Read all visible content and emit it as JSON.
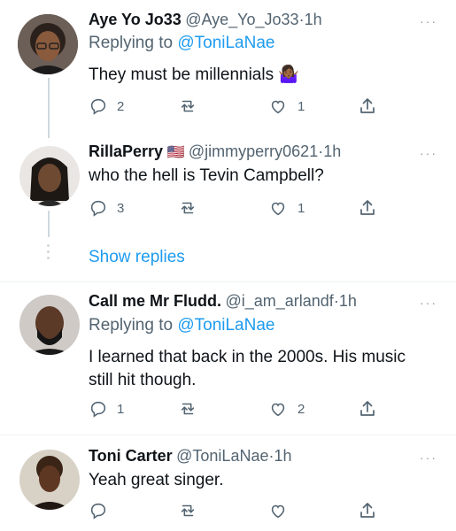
{
  "tweets": [
    {
      "name": "Aye Yo Jo33",
      "handle": "@Aye_Yo_Jo33",
      "time": "1h",
      "reply_prefix": "Replying to",
      "reply_to": "@ToniLaNae",
      "text": "They must be millennials",
      "emoji": "🤷🏾‍♀️",
      "counts": {
        "reply": "2",
        "retweet": "",
        "like": "1"
      }
    },
    {
      "name": "RillaPerry",
      "flag": "🇺🇸",
      "handle": "@jimmyperry0621",
      "time": "1h",
      "text": "who the hell is Tevin Campbell?",
      "counts": {
        "reply": "3",
        "retweet": "",
        "like": "1"
      }
    },
    {
      "name": "Call me Mr Fludd.",
      "handle": "@i_am_arlandf",
      "time": "1h",
      "reply_prefix": "Replying to",
      "reply_to": "@ToniLaNae",
      "text_line1": "I learned that back in the 2000s. His music",
      "text_line2": "still hit though.",
      "counts": {
        "reply": "1",
        "retweet": "",
        "like": "2"
      }
    },
    {
      "name": "Toni Carter",
      "handle": "@ToniLaNae",
      "time": "1h",
      "text": "Yeah great singer.",
      "counts": {
        "reply": "",
        "retweet": "",
        "like": ""
      }
    }
  ],
  "show_replies": "Show replies",
  "more_glyph": "···",
  "sep": "·",
  "colors": {
    "accent": "#1d9bf0",
    "muted": "#536471",
    "thread": "#cfd9de"
  }
}
